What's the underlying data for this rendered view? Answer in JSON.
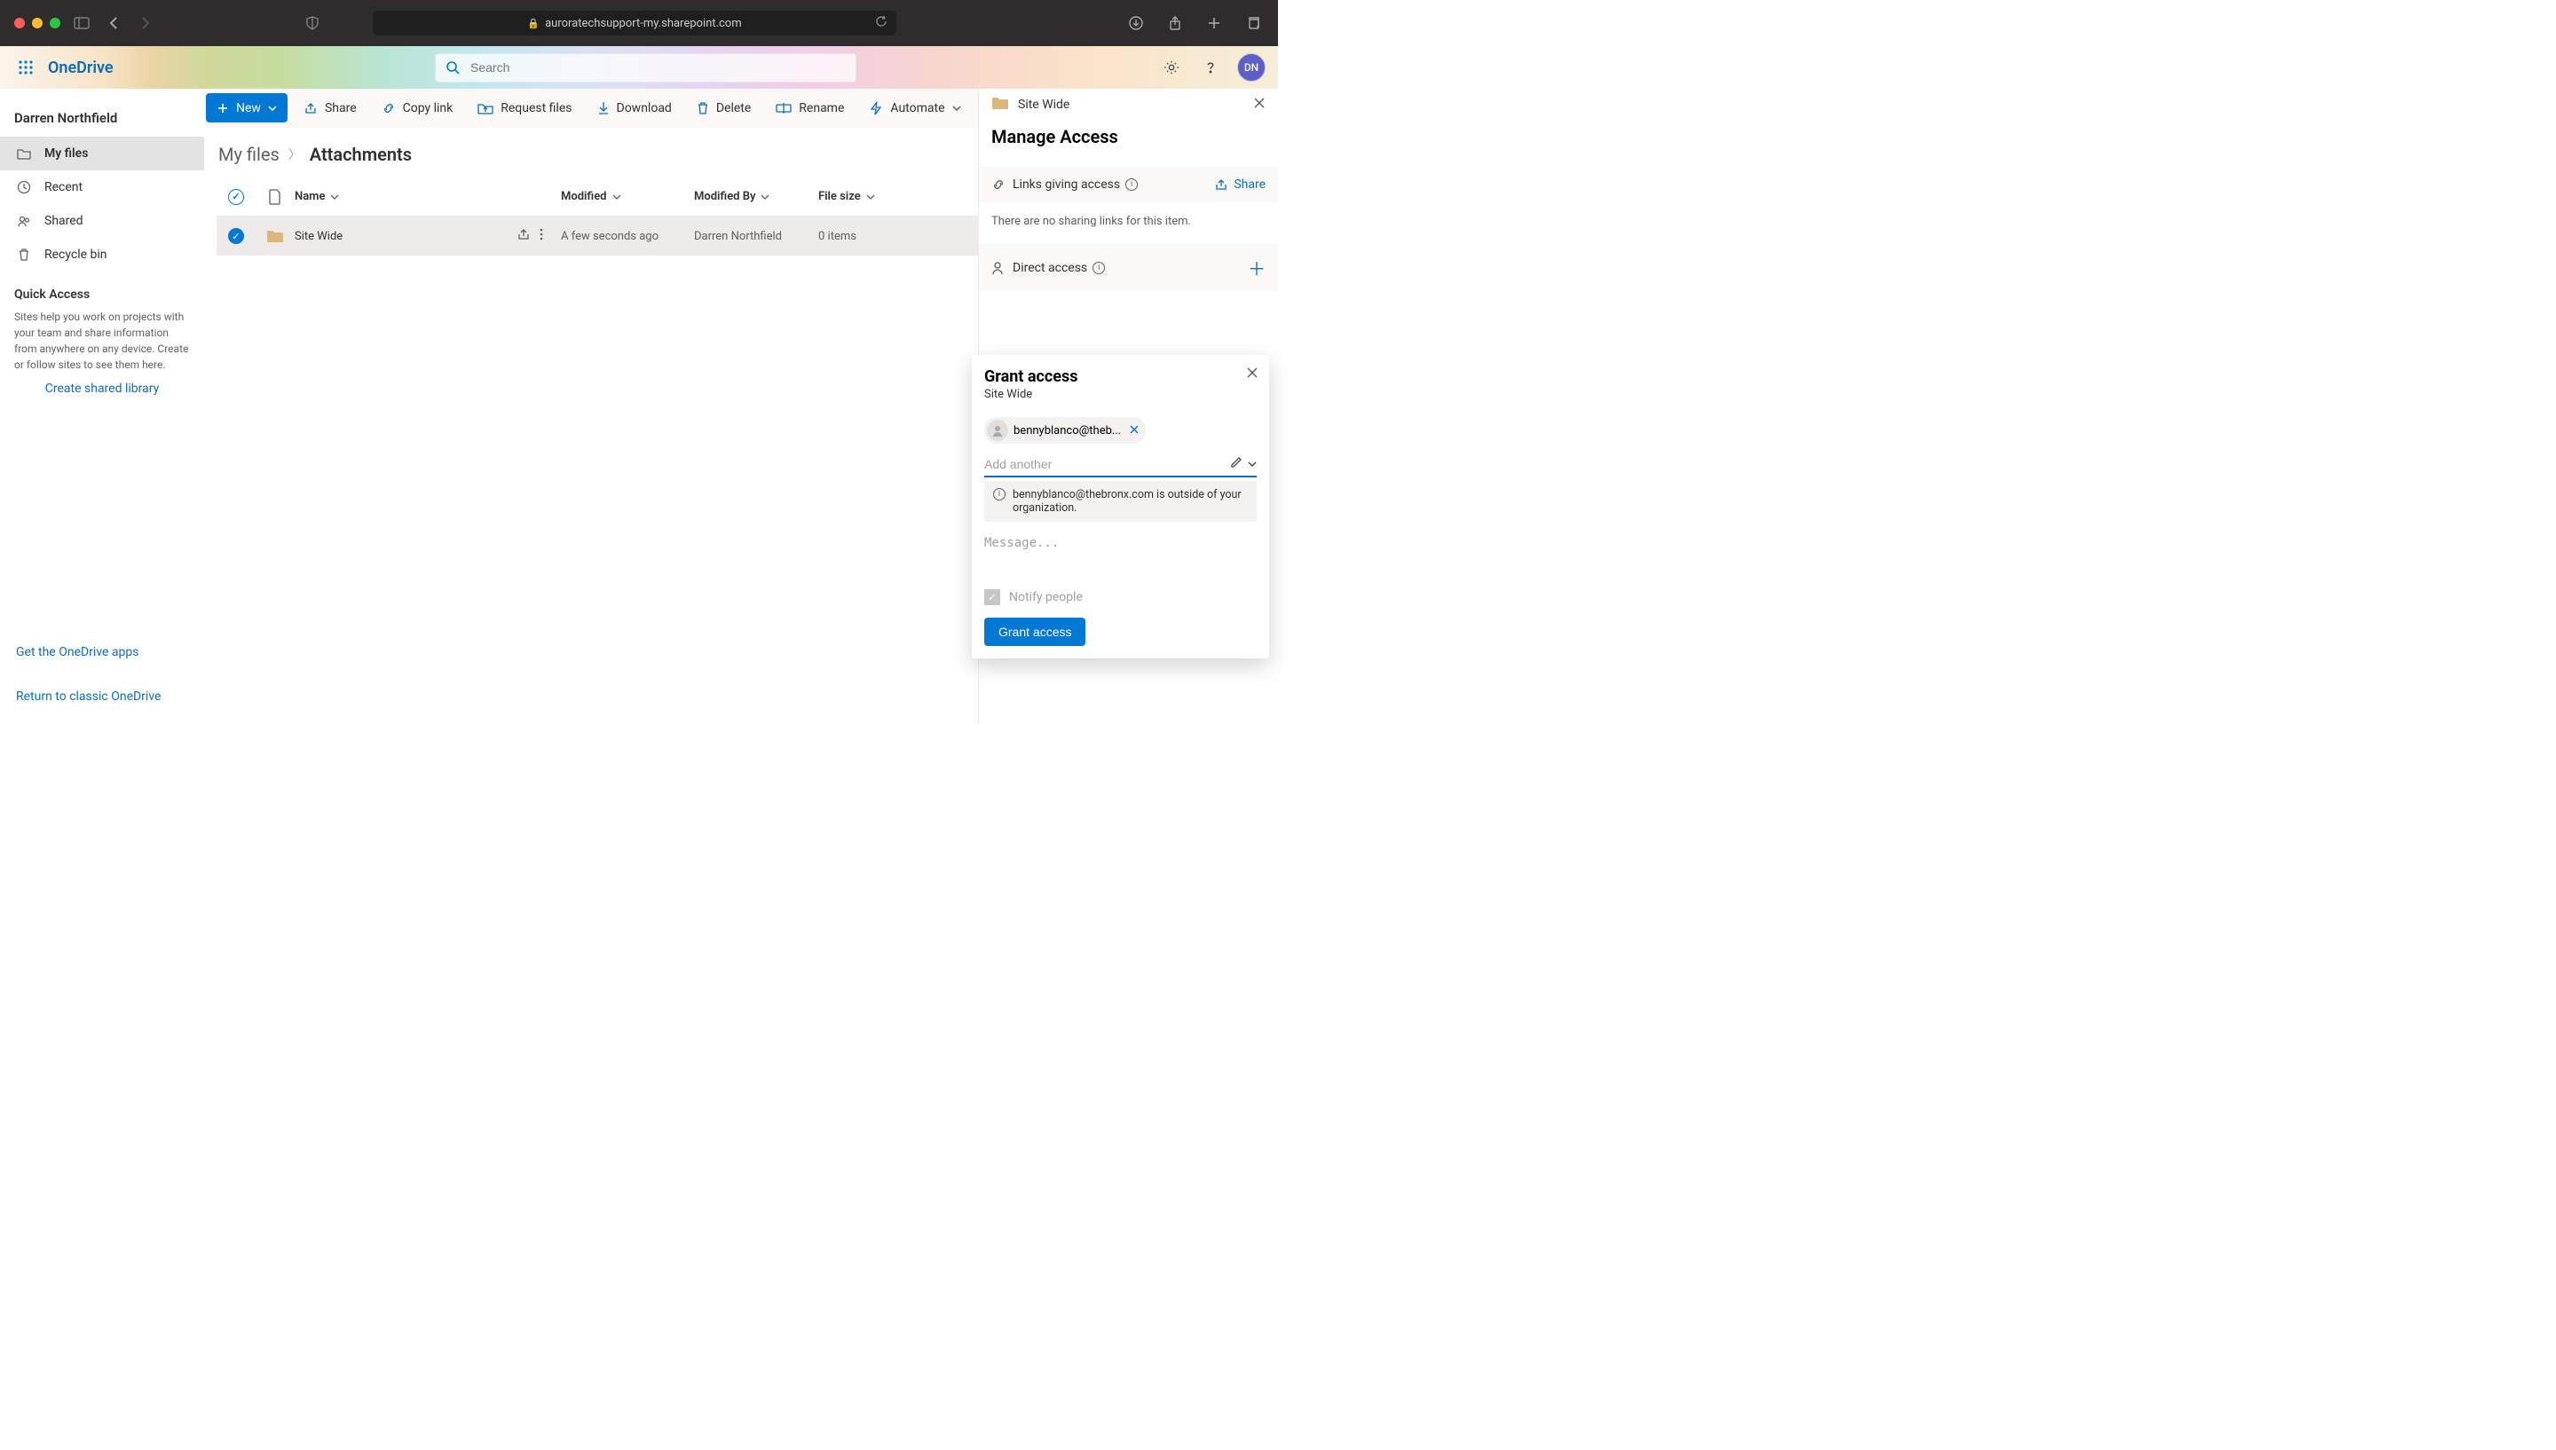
{
  "browser": {
    "url": "auroratechsupport-my.sharepoint.com"
  },
  "app": {
    "name": "OneDrive"
  },
  "search": {
    "placeholder": "Search"
  },
  "user": {
    "initials": "DN"
  },
  "sidebar": {
    "owner": "Darren Northfield",
    "nav": [
      {
        "label": "My files"
      },
      {
        "label": "Recent"
      },
      {
        "label": "Shared"
      },
      {
        "label": "Recycle bin"
      }
    ],
    "quick_access_title": "Quick Access",
    "quick_access_body": "Sites help you work on projects with your team and share information from anywhere on any device. Create or follow sites to see them here.",
    "create_library_link": "Create shared library",
    "get_apps_link": "Get the OneDrive apps",
    "return_classic_link": "Return to classic OneDrive"
  },
  "commands": {
    "new": "New",
    "share": "Share",
    "copylink": "Copy link",
    "requestfiles": "Request files",
    "download": "Download",
    "delete": "Delete",
    "rename": "Rename",
    "automate": "Automate"
  },
  "breadcrumb": {
    "root": "My files",
    "current": "Attachments"
  },
  "columns": {
    "name": "Name",
    "modified": "Modified",
    "modified_by": "Modified By",
    "filesize": "File size"
  },
  "rows": [
    {
      "name": "Site Wide",
      "modified": "A few seconds ago",
      "modified_by": "Darren Northfield",
      "filesize": "0 items"
    }
  ],
  "panel": {
    "item_name": "Site Wide",
    "title": "Manage Access",
    "links_heading": "Links giving access",
    "share_label": "Share",
    "no_links_text": "There are no sharing links for this item.",
    "direct_heading": "Direct access"
  },
  "popover": {
    "title": "Grant access",
    "subtitle": "Site Wide",
    "chip_email": "bennyblanco@theb...",
    "add_placeholder": "Add another",
    "warning": "bennyblanco@thebronx.com is outside of your organization.",
    "message_placeholder": "Message...",
    "notify_label": "Notify people",
    "button": "Grant access"
  }
}
